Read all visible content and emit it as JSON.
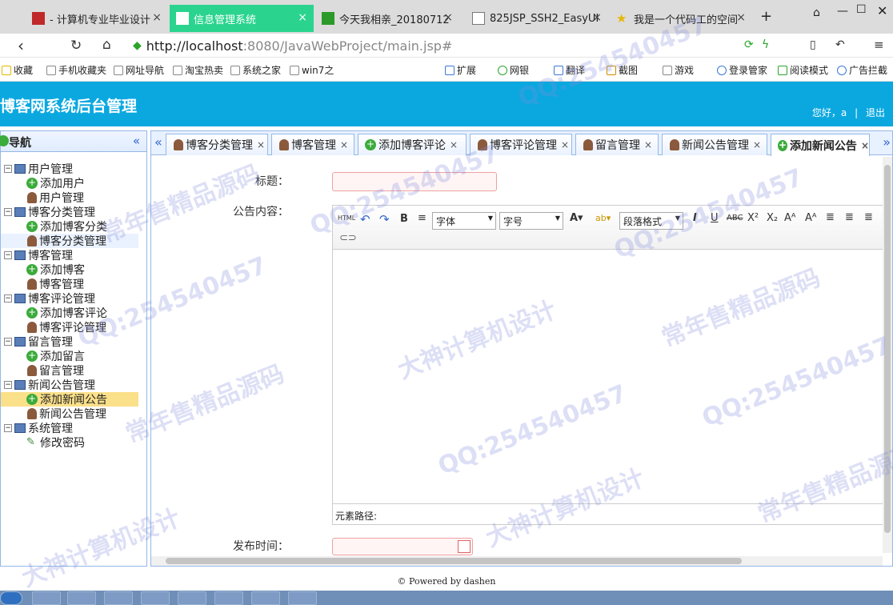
{
  "browser": {
    "tabs": [
      {
        "label": "- 计算机专业毕业设计",
        "active": false
      },
      {
        "label": "信息管理系统",
        "active": true
      },
      {
        "label": "今天我相亲_20180712",
        "active": false
      },
      {
        "label": "825JSP_SSH2_EasyUI",
        "active": false
      },
      {
        "label": "我是一个代码工的空间",
        "active": false
      }
    ],
    "new_tab": "+",
    "url_host": "http://localhost",
    "url_path": ":8080/JavaWebProject/main.jsp#",
    "bookmarks": [
      "收藏",
      "手机收藏夹",
      "网址导航",
      "淘宝热卖",
      "系统之家",
      "win7之",
      "扩展",
      "网银",
      "翻译",
      "截图",
      "游戏",
      "登录管家",
      "阅读模式",
      "广告拦截"
    ]
  },
  "app": {
    "title": "博客网系统后台管理",
    "greeting": "您好，a",
    "logout": "退出"
  },
  "sidebar": {
    "title": "导航",
    "collapse": "«",
    "groups": [
      {
        "label": "用户管理",
        "items": [
          {
            "label": "添加用户",
            "icon": "add-icon"
          },
          {
            "label": "用户管理",
            "icon": "user-icon"
          }
        ]
      },
      {
        "label": "博客分类管理",
        "items": [
          {
            "label": "添加博客分类",
            "icon": "add-icon"
          },
          {
            "label": "博客分类管理",
            "icon": "user-icon"
          }
        ]
      },
      {
        "label": "博客管理",
        "items": [
          {
            "label": "添加博客",
            "icon": "add-icon"
          },
          {
            "label": "博客管理",
            "icon": "user-icon"
          }
        ]
      },
      {
        "label": "博客评论管理",
        "items": [
          {
            "label": "添加博客评论",
            "icon": "add-icon"
          },
          {
            "label": "博客评论管理",
            "icon": "user-icon"
          }
        ]
      },
      {
        "label": "留言管理",
        "items": [
          {
            "label": "添加留言",
            "icon": "add-icon"
          },
          {
            "label": "留言管理",
            "icon": "user-icon"
          }
        ]
      },
      {
        "label": "新闻公告管理",
        "items": [
          {
            "label": "添加新闻公告",
            "icon": "add-icon"
          },
          {
            "label": "新闻公告管理",
            "icon": "user-icon"
          }
        ]
      },
      {
        "label": "系统管理",
        "items": [
          {
            "label": "修改密码",
            "icon": "pencil-icon"
          }
        ]
      }
    ]
  },
  "tabs": [
    {
      "label": "博客分类管理",
      "icon": "user-icon",
      "active": false
    },
    {
      "label": "博客管理",
      "icon": "user-icon",
      "active": false
    },
    {
      "label": "添加博客评论",
      "icon": "add-icon",
      "active": false
    },
    {
      "label": "博客评论管理",
      "icon": "user-icon",
      "active": false
    },
    {
      "label": "留言管理",
      "icon": "user-icon",
      "active": false
    },
    {
      "label": "新闻公告管理",
      "icon": "user-icon",
      "active": false
    },
    {
      "label": "添加新闻公告",
      "icon": "add-icon",
      "active": true
    }
  ],
  "form": {
    "title_label": "标题：",
    "content_label": "公告内容：",
    "publish_time_label": "发布时间："
  },
  "editor": {
    "html_btn": "HTML",
    "font_family": "字体",
    "font_size": "字号",
    "paragraph": "段落格式",
    "element_path": "元素路径:"
  },
  "footer": "© Powered by dashen",
  "watermarks": [
    "QQ:254540457",
    "常年售精品源码",
    "大神计算机设计"
  ]
}
